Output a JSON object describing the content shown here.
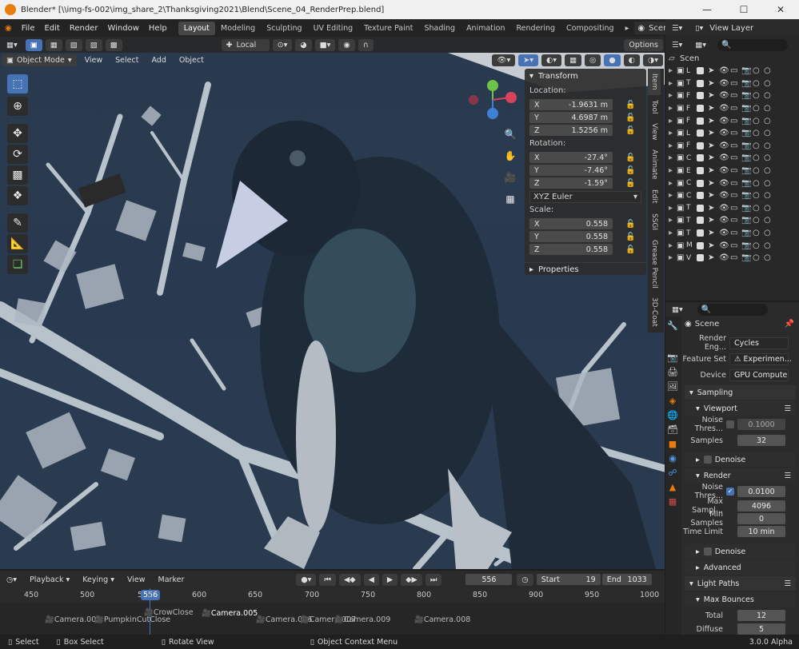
{
  "window": {
    "title": "Blender* [\\\\img-fs-002\\img_share_2\\Thanksgiving2021\\Blend\\Scene_04_RenderPrep.blend]"
  },
  "menu": [
    "File",
    "Edit",
    "Render",
    "Window",
    "Help"
  ],
  "workspaces": [
    "Layout",
    "Modeling",
    "Sculpting",
    "UV Editing",
    "Texture Paint",
    "Shading",
    "Animation",
    "Rendering",
    "Compositing"
  ],
  "scene_name": "Scene",
  "view_layer": "View Layer",
  "viewport": {
    "transform_orientation": "Local",
    "options_label": "Options",
    "mode": "Object Mode",
    "menus": [
      "View",
      "Select",
      "Add",
      "Object"
    ]
  },
  "npanel": {
    "transform_label": "Transform",
    "location_label": "Location:",
    "location": [
      {
        "axis": "X",
        "value": "-1.9631 m"
      },
      {
        "axis": "Y",
        "value": "4.6987 m"
      },
      {
        "axis": "Z",
        "value": "1.5256 m"
      }
    ],
    "rotation_label": "Rotation:",
    "rotation": [
      {
        "axis": "X",
        "value": "-27.4°"
      },
      {
        "axis": "Y",
        "value": "-7.46°"
      },
      {
        "axis": "Z",
        "value": "-1.59°"
      }
    ],
    "rotation_mode": "XYZ Euler",
    "scale_label": "Scale:",
    "scale": [
      {
        "axis": "X",
        "value": "0.558"
      },
      {
        "axis": "Y",
        "value": "0.558"
      },
      {
        "axis": "Z",
        "value": "0.558"
      }
    ],
    "properties_label": "Properties"
  },
  "sidetabs": [
    "Item",
    "Tool",
    "View",
    "Animate",
    "Edit",
    "SSGI",
    "Grease Pencil",
    "3D-Coat"
  ],
  "timeline": {
    "menus": [
      "Playback",
      "Keying",
      "View",
      "Marker"
    ],
    "current_frame": "556",
    "start_label": "Start",
    "start": "19",
    "end_label": "End",
    "end": "1033",
    "ruler": [
      "450",
      "500",
      "5",
      "600",
      "650",
      "700",
      "750",
      "800",
      "850",
      "900",
      "950",
      "1000"
    ],
    "playhead": "556",
    "markers": [
      {
        "label": "Camera.002"
      },
      {
        "label": "PumpkinCutClose"
      },
      {
        "label": "CrowClose"
      },
      {
        "label": "Camera.005"
      },
      {
        "label": "Camera.006"
      },
      {
        "label": "Camera.007"
      },
      {
        "label": "Camera.009"
      },
      {
        "label": "Camera.008"
      }
    ]
  },
  "status": {
    "items": [
      "Select",
      "Box Select",
      "Rotate View",
      "Object Context Menu"
    ],
    "version": "3.0.0 Alpha"
  },
  "outliner": {
    "root": "Scen",
    "rows": [
      "L",
      "T",
      "F",
      "F",
      "F",
      "L",
      "F",
      "C",
      "E",
      "C",
      "C",
      "T",
      "T",
      "T",
      "M",
      "V"
    ]
  },
  "properties": {
    "scene_label": "Scene",
    "render_engine_label": "Render Eng...",
    "render_engine": "Cycles",
    "feature_set_label": "Feature Set",
    "feature_set": "Experimen...",
    "device_label": "Device",
    "device": "GPU Compute",
    "sampling": "Sampling",
    "viewport": "Viewport",
    "vp_noise_label": "Noise Thres...",
    "vp_noise": "0.1000",
    "vp_samples_label": "Samples",
    "vp_samples": "32",
    "denoise": "Denoise",
    "render": "Render",
    "r_noise_label": "Noise Thres...",
    "r_noise": "0.0100",
    "max_samples_label": "Max Sampl...",
    "max_samples": "4096",
    "min_samples_label": "Min Samples",
    "min_samples": "0",
    "time_limit_label": "Time Limit",
    "time_limit": "10 min",
    "denoise2": "Denoise",
    "advanced": "Advanced",
    "light_paths": "Light Paths",
    "max_bounces": "Max Bounces",
    "total_label": "Total",
    "total": "12",
    "diffuse_label": "Diffuse",
    "diffuse": "5"
  },
  "colors": {
    "accent": "#4772b3",
    "active_tab": "#474747",
    "orange": "#e87d0d"
  }
}
